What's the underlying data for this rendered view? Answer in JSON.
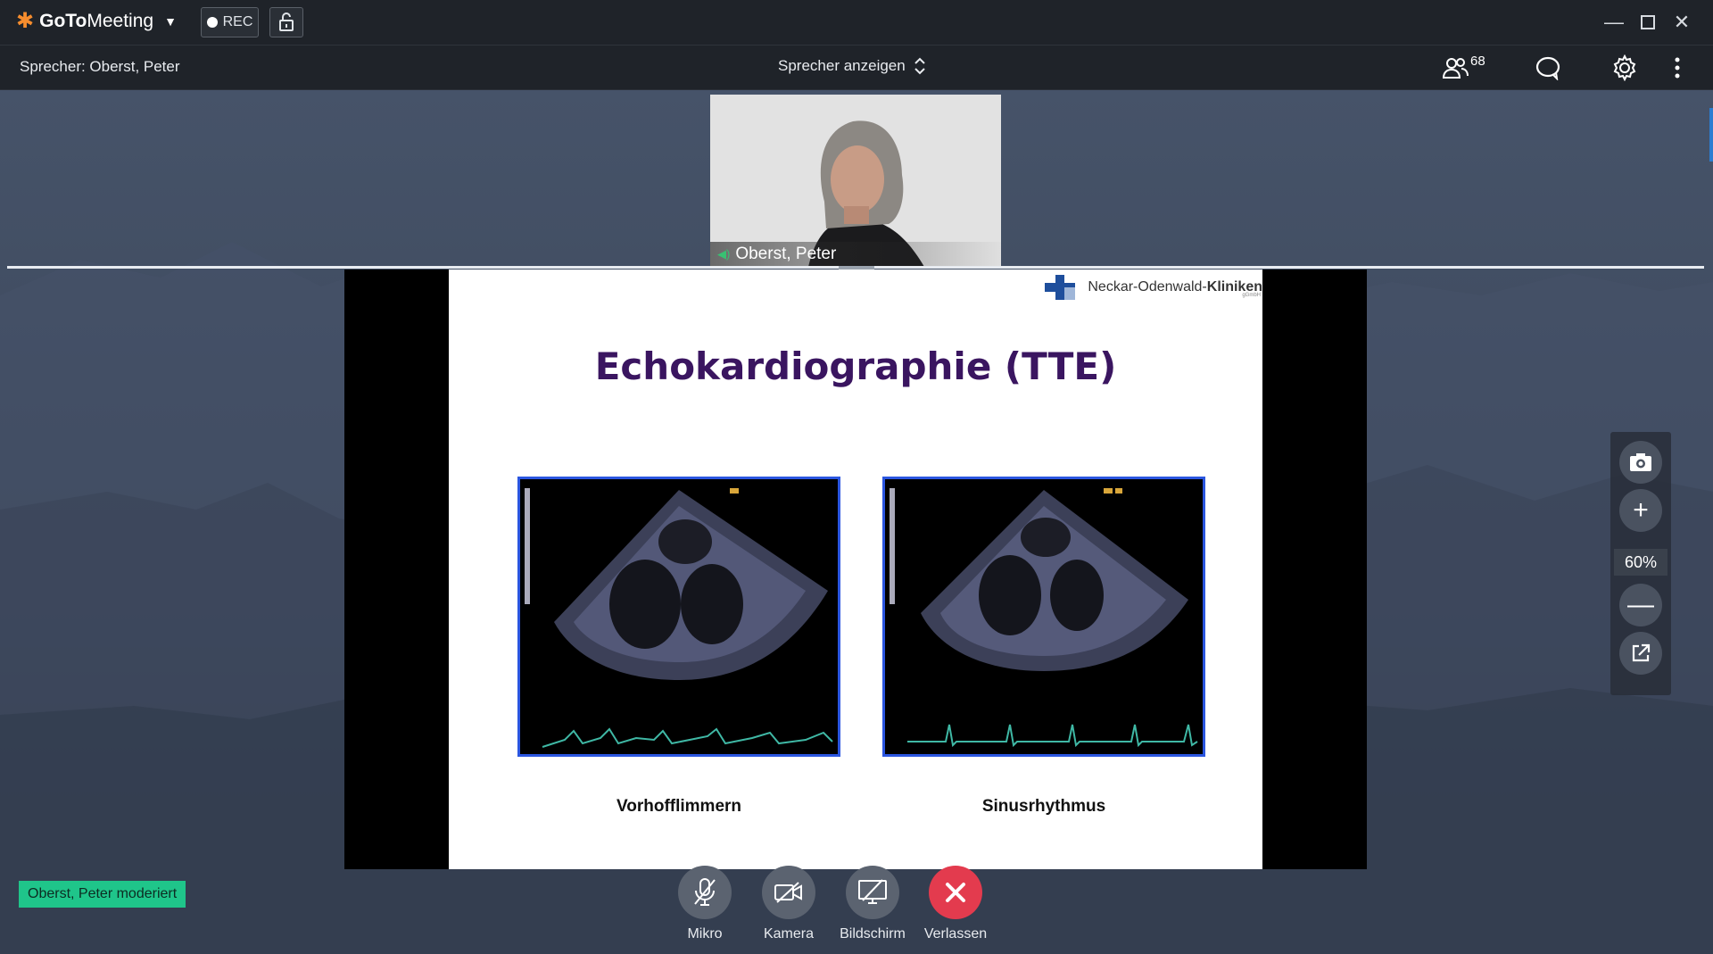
{
  "app": {
    "brand_goto": "GoTo",
    "brand_meeting": "Meeting",
    "rec_label": "REC"
  },
  "header": {
    "speaker_text": "Sprecher: Oberst, Peter",
    "view_mode": "Sprecher anzeigen",
    "participant_count": "68"
  },
  "webcam": {
    "name": "Oberst, Peter"
  },
  "slide": {
    "clinic_name_prefix": "Neckar-Odenwald-",
    "clinic_name_bold": "Kliniken",
    "clinic_sub": "gGmbH",
    "title": "Echokardiographie (TTE)",
    "left_caption": "Vorhofflimmern",
    "right_caption": "Sinusrhythmus"
  },
  "zoom": {
    "level": "60%"
  },
  "moderator_badge": "Oberst, Peter moderiert",
  "controls": {
    "mic_label": "Mikro",
    "camera_label": "Kamera",
    "screen_label": "Bildschirm",
    "leave_label": "Verlassen"
  },
  "colors": {
    "accent_orange": "#f68d2e",
    "moderator_green": "#1fc58a",
    "leave_red": "#e33b4e",
    "slide_title_purple": "#3a1560",
    "echo_border_blue": "#2b56e0"
  }
}
